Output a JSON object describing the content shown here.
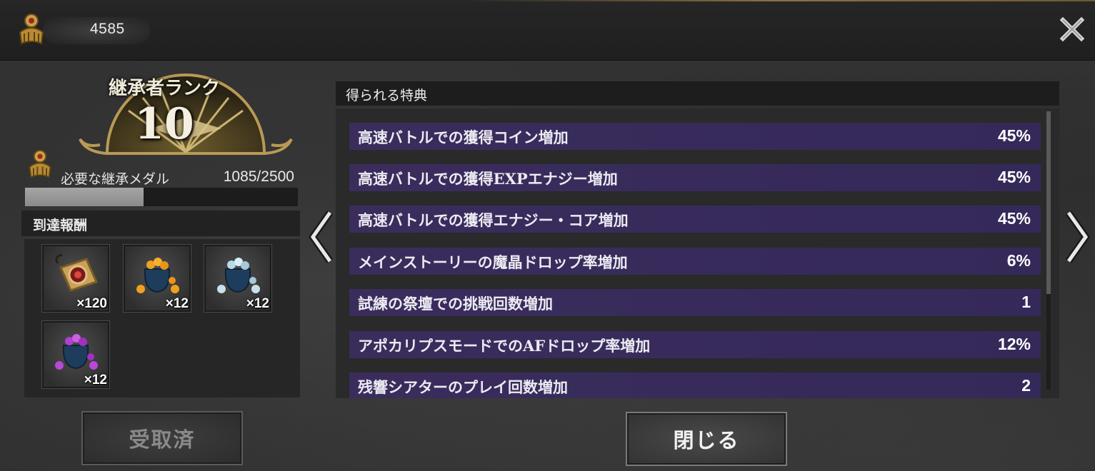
{
  "header": {
    "currency_value": "4585",
    "currency_icon": "medal-icon",
    "close_icon": "close-icon"
  },
  "rank": {
    "title": "継承者ランク",
    "number": "10",
    "medal_label": "必要な継承メダル",
    "medal_count": "1085/2500",
    "progress_fraction": 0.434
  },
  "rewards": {
    "header": "到達報酬",
    "items": [
      {
        "icon": "amulet-icon",
        "qty": "×120"
      },
      {
        "icon": "gold-pouch-icon",
        "qty": "×12"
      },
      {
        "icon": "silver-pouch-icon",
        "qty": "×12"
      },
      {
        "icon": "purple-pouch-icon",
        "qty": "×12"
      }
    ],
    "button_label": "受取済"
  },
  "benefits": {
    "header": "得られる特典",
    "rows": [
      {
        "name": "高速バトルでの獲得コイン増加",
        "value": "45%"
      },
      {
        "name": "高速バトルでの獲得EXPエナジー増加",
        "value": "45%"
      },
      {
        "name": "高速バトルでの獲得エナジー・コア増加",
        "value": "45%"
      },
      {
        "name": "メインストーリーの魔晶ドロップ率増加",
        "value": "6%"
      },
      {
        "name": "試練の祭壇での挑戦回数増加",
        "value": "1"
      },
      {
        "name": "アポカリプスモードでのAFドロップ率増加",
        "value": "12%"
      },
      {
        "name": "残響シアターのプレイ回数増加",
        "value": "2"
      }
    ]
  },
  "footer": {
    "close_label": "閉じる"
  },
  "colors": {
    "row_purple": "#3a2d5c",
    "gold": "#c9a24a"
  }
}
